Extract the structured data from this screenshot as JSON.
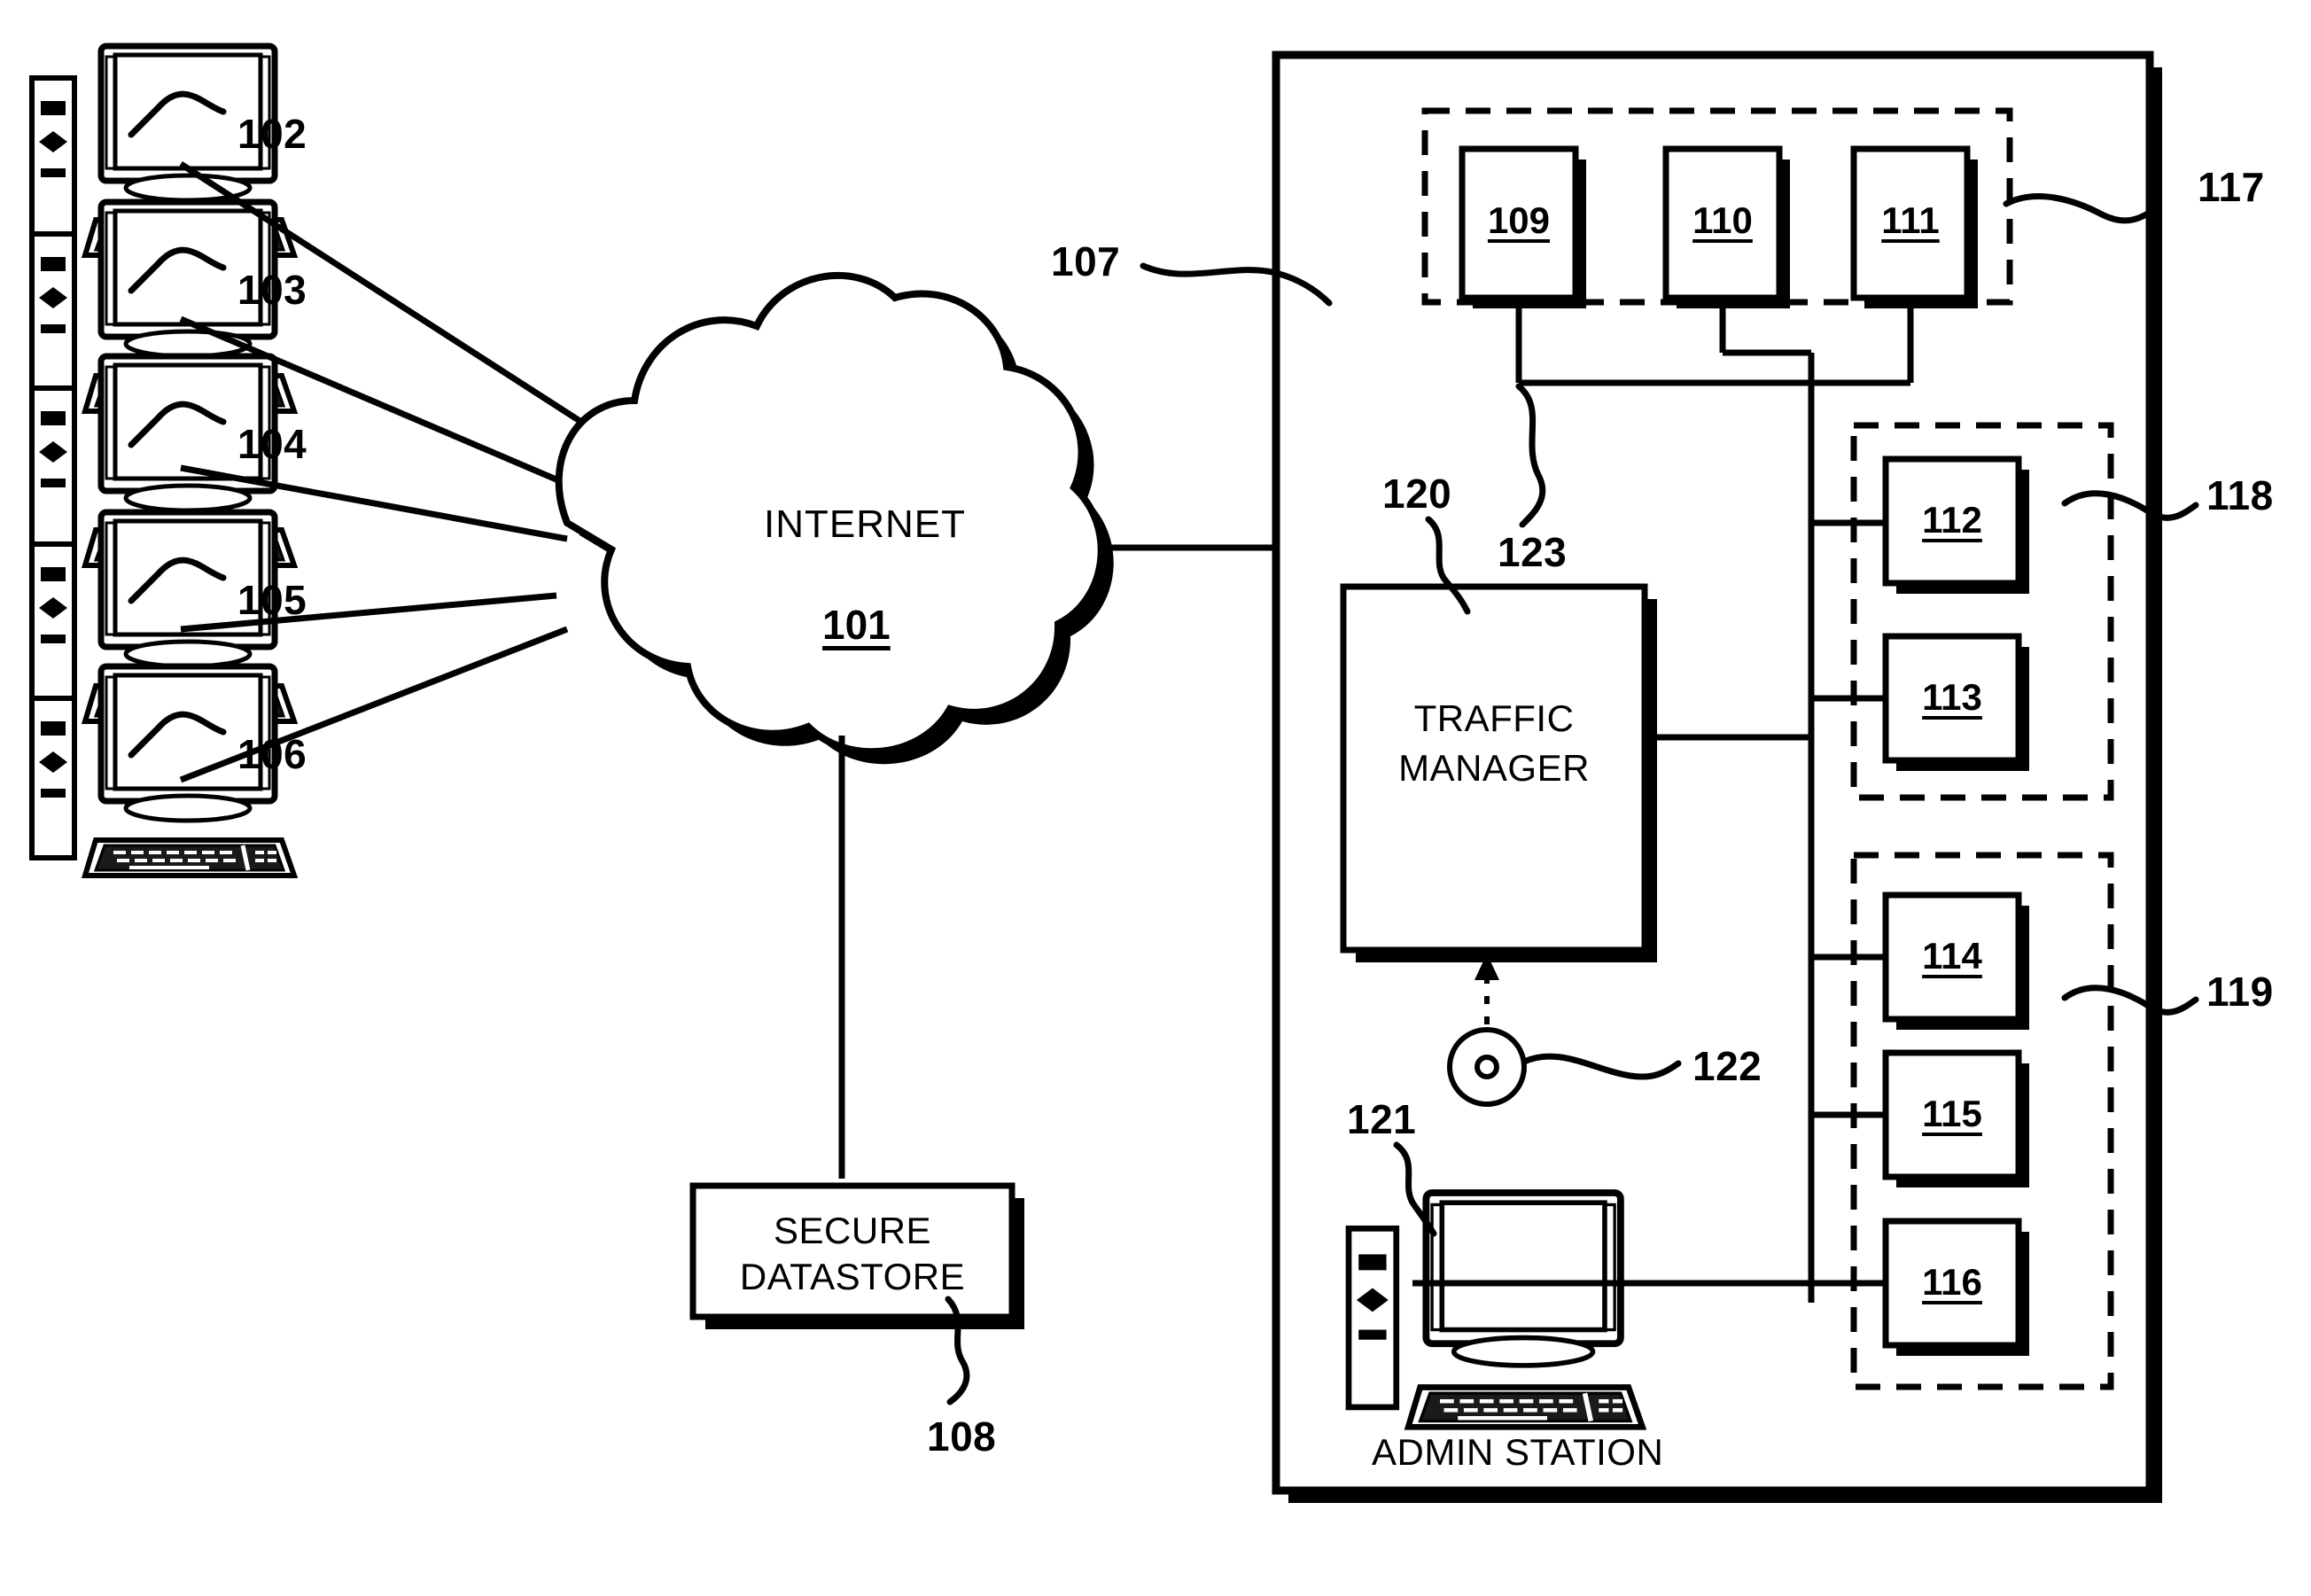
{
  "figure": {
    "type": "patent-network-diagram",
    "background_color": "#ffffff",
    "line_color": "#000000"
  },
  "cloud": {
    "label": "INTERNET",
    "ref": "101"
  },
  "clients": [
    {
      "ref": "102",
      "name": "client-workstation-102"
    },
    {
      "ref": "103",
      "name": "client-workstation-103"
    },
    {
      "ref": "104",
      "name": "client-workstation-104"
    },
    {
      "ref": "105",
      "name": "client-workstation-105"
    },
    {
      "ref": "106",
      "name": "client-workstation-106"
    }
  ],
  "datastore": {
    "line1": "SECURE",
    "line2": "DATASTORE",
    "ref": "108"
  },
  "enterprise": {
    "ref": "107"
  },
  "traffic_manager": {
    "line1": "TRAFFIC",
    "line2": "MANAGER",
    "ref": "120"
  },
  "admin_station": {
    "label": "ADMIN STATION",
    "ref": "121"
  },
  "wireless_node": {
    "ref": "122"
  },
  "bus": {
    "ref": "123"
  },
  "server_groups": [
    {
      "ref": "117",
      "name": "server-group-117",
      "members": [
        "109",
        "110",
        "111"
      ]
    },
    {
      "ref": "118",
      "name": "server-group-118",
      "members": [
        "112",
        "113"
      ]
    },
    {
      "ref": "119",
      "name": "server-group-119",
      "members": [
        "114",
        "115",
        "116"
      ]
    }
  ],
  "servers": [
    {
      "ref": "109"
    },
    {
      "ref": "110"
    },
    {
      "ref": "111"
    },
    {
      "ref": "112"
    },
    {
      "ref": "113"
    },
    {
      "ref": "114"
    },
    {
      "ref": "115"
    },
    {
      "ref": "116"
    }
  ]
}
